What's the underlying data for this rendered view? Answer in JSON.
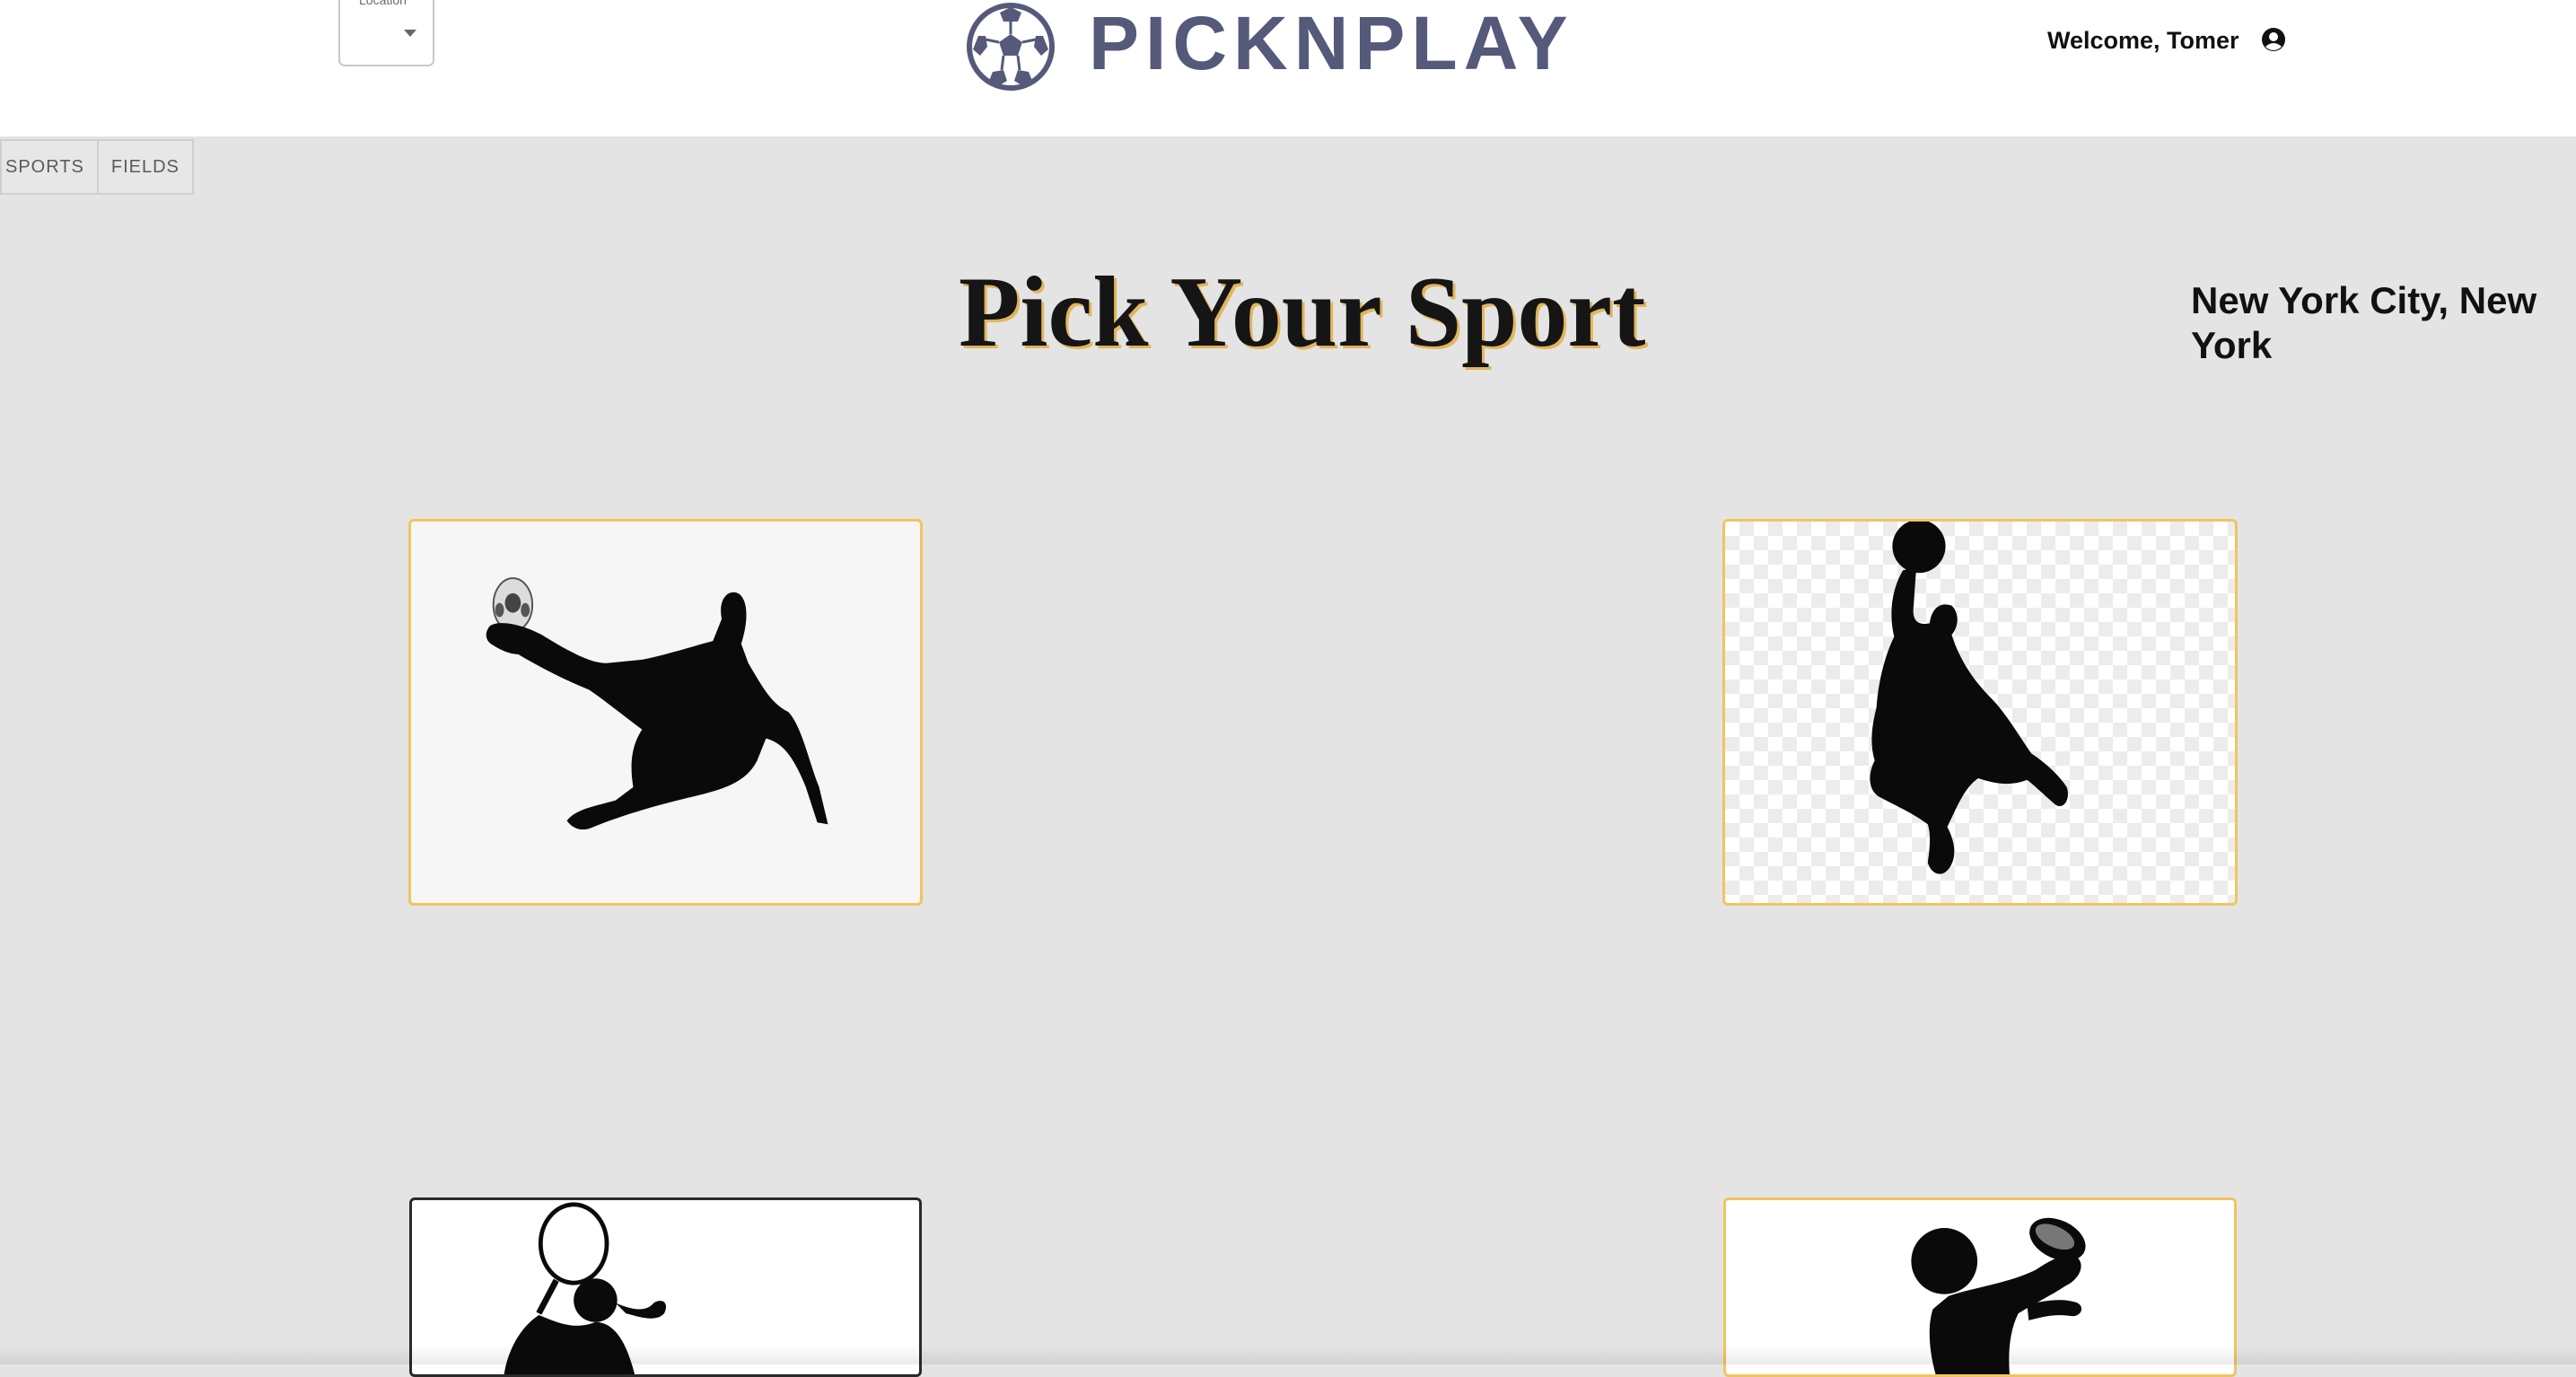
{
  "header": {
    "location": {
      "label": "Location",
      "value": ""
    },
    "logo_text": "PICKNPLAY",
    "welcome": "Welcome, Tomer",
    "user_icon": "user-circle-icon"
  },
  "nav": {
    "items": [
      {
        "label": "SPORTS"
      },
      {
        "label": "FIELDS"
      }
    ]
  },
  "main": {
    "title": "Pick Your Sport",
    "city": "New York City, New York"
  },
  "colors": {
    "background": "#e4e4e4",
    "header": "#ffffff",
    "card_border": "#f1c462",
    "logo": "#55597a",
    "title_shadow": "#e2b55a"
  },
  "icons": [
    "soccer-ball-icon",
    "user-circle-icon",
    "soccer-player-image",
    "basketball-player-image",
    "tennis-player-image",
    "football-player-image"
  ]
}
